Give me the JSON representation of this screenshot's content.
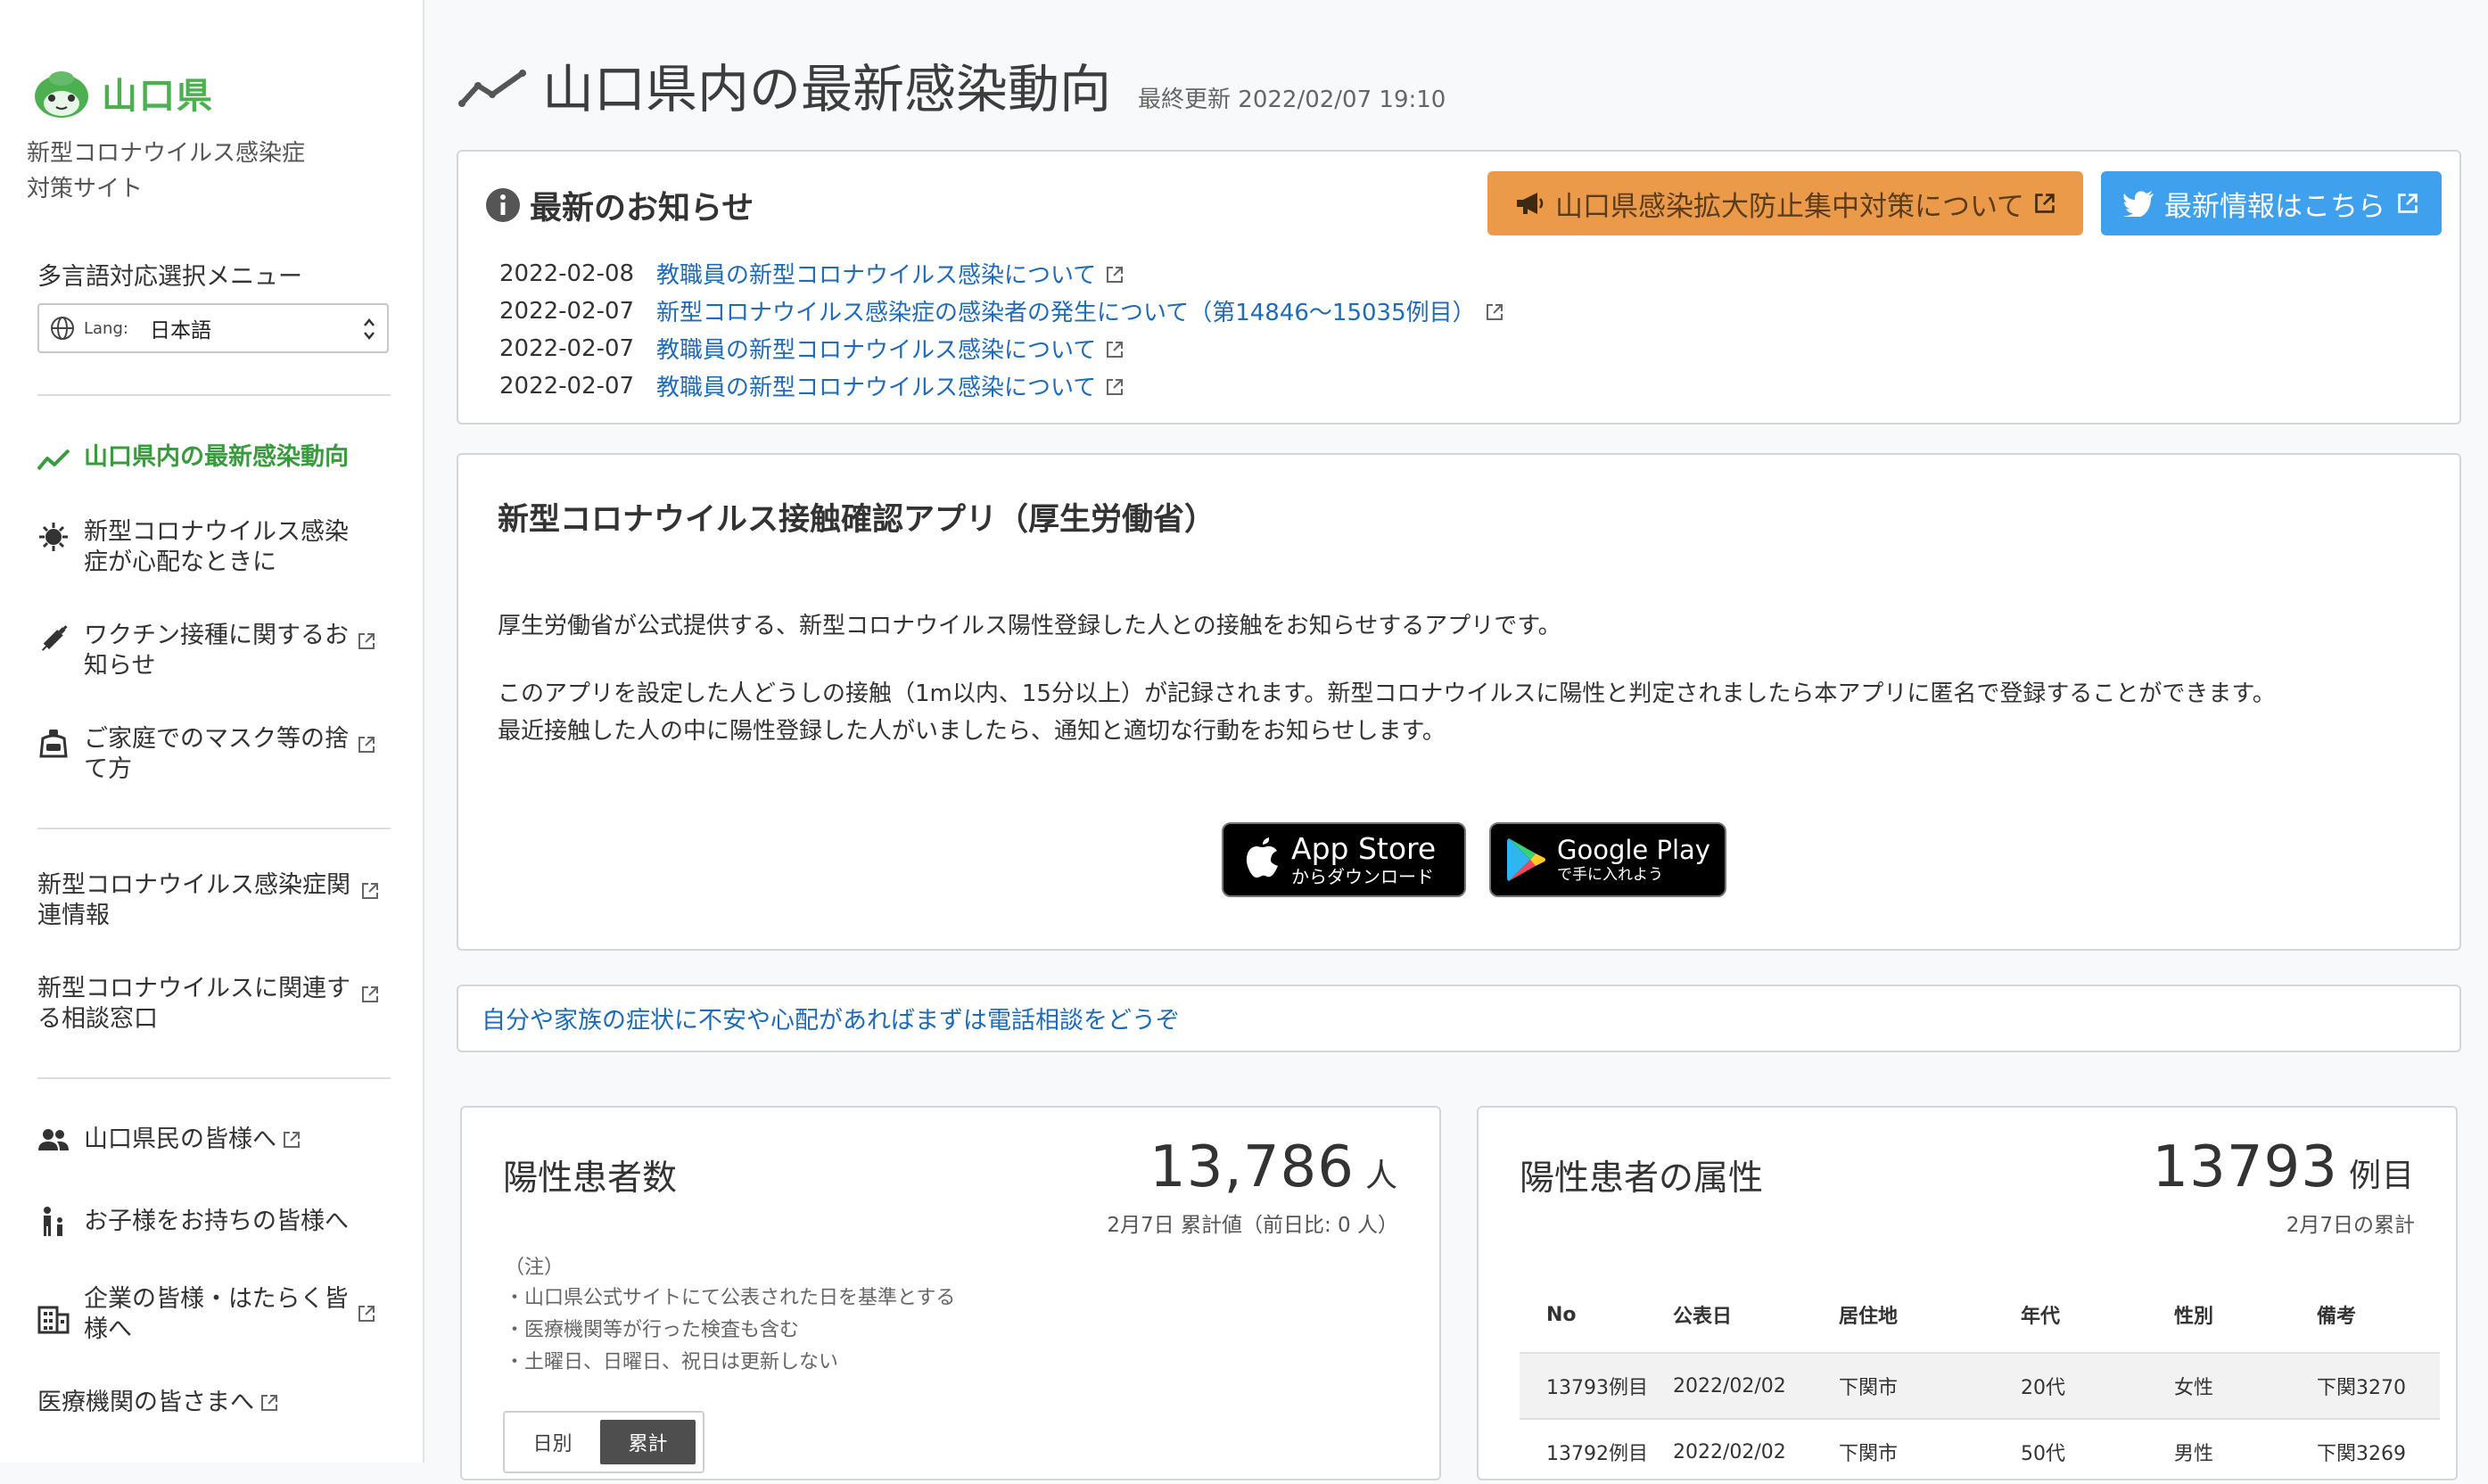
{
  "sidebar": {
    "brand": "山口県",
    "subtitle_line1": "新型コロナウイルス感染症",
    "subtitle_line2": "対策サイト",
    "lang_title": "多言語対応選択メニュー",
    "lang_label": "Lang:",
    "lang_value": "日本語",
    "nav": [
      {
        "label": "山口県内の最新感染動向",
        "icon": "chart-line-icon"
      },
      {
        "label": "新型コロナウイルス感染症が心配なときに",
        "icon": "virus-icon"
      },
      {
        "label": "ワクチン接種に関するお知らせ",
        "icon": "syringe-icon"
      },
      {
        "label": "ご家庭でのマスク等の捨て方",
        "icon": "trash-bag-icon"
      }
    ],
    "links": [
      {
        "label": "新型コロナウイルス感染症関連情報"
      },
      {
        "label": "新型コロナウイルスに関連する相談窓口"
      }
    ],
    "audience": [
      {
        "label": "山口県民の皆様へ",
        "icon": "people-icon"
      },
      {
        "label": "お子様をお持ちの皆様へ",
        "icon": "parent-child-icon"
      },
      {
        "label": "企業の皆様・はたらく皆様へ",
        "icon": "building-icon"
      },
      {
        "label": "医療機関の皆さまへ"
      }
    ]
  },
  "header": {
    "title": "山口県内の最新感染動向",
    "last_update": "最終更新 2022/02/07 19:10"
  },
  "news": {
    "title": "最新のお知らせ",
    "btn_measures": "山口県感染拡大防止集中対策について",
    "btn_twitter": "最新情報はこちら",
    "items": [
      {
        "date": "2022-02-08",
        "text": "教職員の新型コロナウイルス感染について"
      },
      {
        "date": "2022-02-07",
        "text": "新型コロナウイルス感染症の感染者の発生について（第14846〜15035例目）"
      },
      {
        "date": "2022-02-07",
        "text": "教職員の新型コロナウイルス感染について"
      },
      {
        "date": "2022-02-07",
        "text": "教職員の新型コロナウイルス感染について"
      }
    ]
  },
  "app": {
    "title": "新型コロナウイルス接触確認アプリ（厚生労働省）",
    "p1": "厚生労働省が公式提供する、新型コロナウイルス陽性登録した人との接触をお知らせするアプリです。",
    "p2": "このアプリを設定した人どうしの接触（1m以内、15分以上）が記録されます。新型コロナウイルスに陽性と判定されましたら本アプリに匿名で登録することができます。",
    "p3": "最近接触した人の中に陽性登録した人がいましたら、通知と適切な行動をお知らせします。",
    "appstore_main": "App Store",
    "appstore_sub": "からダウンロード",
    "gplay_main": "Google Play",
    "gplay_sub": "で手に入れよう"
  },
  "consult": {
    "text": "自分や家族の症状に不安や心配があればまずは電話相談をどうぞ"
  },
  "positives": {
    "title": "陽性患者数",
    "value": "13,786",
    "unit": "人",
    "sub": "2月7日 累計値（前日比: 0 人）",
    "note_head": "（注）",
    "notes": [
      "・山口県公式サイトにて公表された日を基準とする",
      "・医療機関等が行った検査も含む",
      "・土曜日、日曜日、祝日は更新しない"
    ],
    "toggle_daily": "日別",
    "toggle_total": "累計"
  },
  "attributes": {
    "title": "陽性患者の属性",
    "value": "13793",
    "unit": "例目",
    "sub": "2月7日の累計",
    "columns": [
      "No",
      "公表日",
      "居住地",
      "年代",
      "性別",
      "備考"
    ],
    "rows": [
      [
        "13793例目",
        "2022/02/02",
        "下関市",
        "20代",
        "女性",
        "下関3270"
      ],
      [
        "13792例目",
        "2022/02/02",
        "下関市",
        "50代",
        "男性",
        "下関3269"
      ]
    ]
  },
  "colors": {
    "brand_green": "#4caf50",
    "orange_button": "#eb9a4a",
    "twitter_blue": "#3fa0ee",
    "link_blue": "#1f6bb8"
  }
}
